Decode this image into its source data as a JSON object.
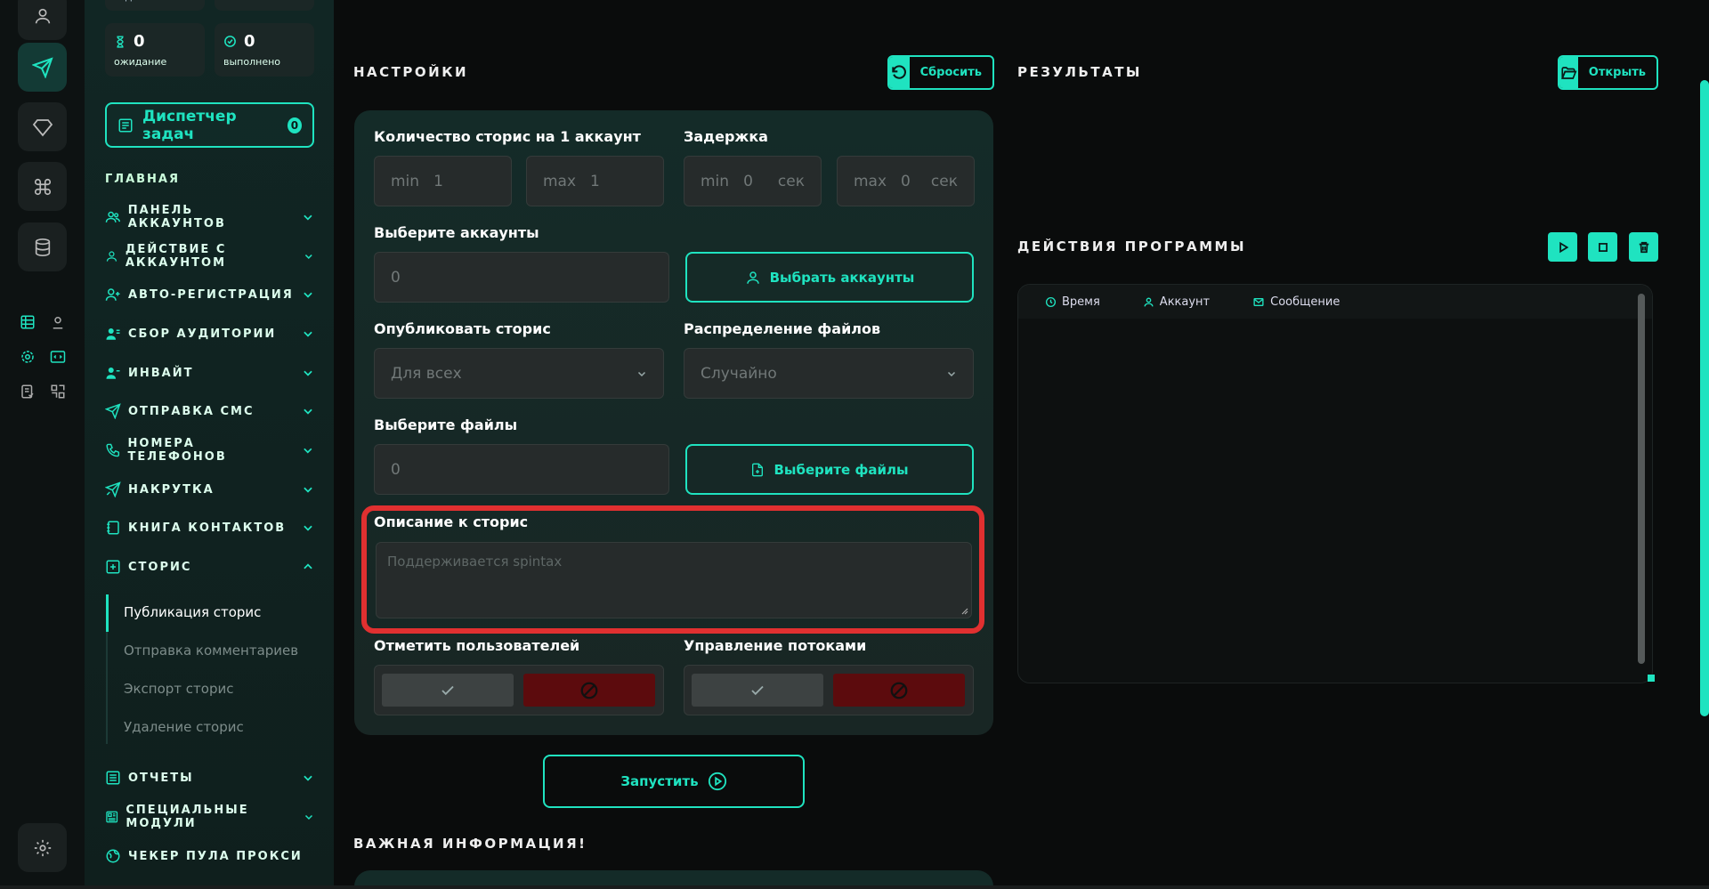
{
  "stats": {
    "tasks_label": "заданий",
    "threads_label": "потоков",
    "waiting": {
      "value": "0",
      "label": "ожидание"
    },
    "done": {
      "value": "0",
      "label": "выполнено"
    }
  },
  "dispatcher": {
    "label": "Диспетчер задач",
    "count": "0"
  },
  "sidebar": {
    "section_title": "ГЛАВНАЯ",
    "items": [
      {
        "label": "ПАНЕЛЬ АККАУНТОВ",
        "icon": "users-icon"
      },
      {
        "label": "ДЕЙСТВИЕ С АККАУНТОМ",
        "icon": "user-icon"
      },
      {
        "label": "АВТО-РЕГИСТРАЦИЯ",
        "icon": "user-plus-icon"
      },
      {
        "label": "СБОР АУДИТОРИИ",
        "icon": "audience-icon"
      },
      {
        "label": "ИНВАЙТ",
        "icon": "invite-icon"
      },
      {
        "label": "ОТПРАВКА СМС",
        "icon": "send-icon"
      },
      {
        "label": "НОМЕРА ТЕЛЕФОНОВ",
        "icon": "phone-icon"
      },
      {
        "label": "НАКРУТКА",
        "icon": "boost-icon"
      },
      {
        "label": "КНИГА КОНТАКТОВ",
        "icon": "book-icon"
      },
      {
        "label": "СТОРИС",
        "icon": "plus-square-icon"
      }
    ],
    "stories_sub": [
      "Публикация сторис",
      "Отправка комментариев",
      "Экспорт сторис",
      "Удаление сторис"
    ],
    "bottom_items": [
      {
        "label": "ОТЧЕТЫ",
        "icon": "report-icon"
      },
      {
        "label": "СПЕЦИАЛЬНЫЕ МОДУЛИ",
        "icon": "modules-icon"
      },
      {
        "label": "ЧЕКЕР ПУЛА ПРОКСИ",
        "icon": "proxy-icon"
      }
    ]
  },
  "settings": {
    "title": "НАСТРОЙКИ",
    "reset_label": "Сбросить",
    "stories_count_label": "Количество сторис на 1 аккаунт",
    "delay_label": "Задержка",
    "min_prefix": "min",
    "max_prefix": "max",
    "stories_min": "1",
    "stories_max": "1",
    "delay_min": "0",
    "delay_max": "0",
    "sec_unit": "сек",
    "accounts_label": "Выберите аккаунты",
    "accounts_value": "0",
    "select_accounts_btn": "Выбрать аккаунты",
    "publish_label": "Опубликовать сторис",
    "publish_value": "Для всех",
    "distribution_label": "Распределение файлов",
    "distribution_value": "Случайно",
    "files_label": "Выберите файлы",
    "files_value": "0",
    "select_files_btn": "Выберите файлы",
    "description_label": "Описание к сторис",
    "description_placeholder": "Поддерживается spintax",
    "mark_users_label": "Отметить пользователей",
    "threads_label": "Управление потоками",
    "run_label": "Запустить"
  },
  "info": {
    "title": "ВАЖНАЯ ИНФОРМАЦИЯ!"
  },
  "results": {
    "title": "РЕЗУЛЬТАТЫ",
    "open_label": "Открыть"
  },
  "log": {
    "title": "ДЕЙСТВИЯ ПРОГРАММЫ",
    "columns": [
      "Время",
      "Аккаунт",
      "Сообщение"
    ]
  },
  "colors": {
    "accent": "#1fe3c0",
    "danger": "#5c0b0d",
    "highlight": "#e03030"
  }
}
